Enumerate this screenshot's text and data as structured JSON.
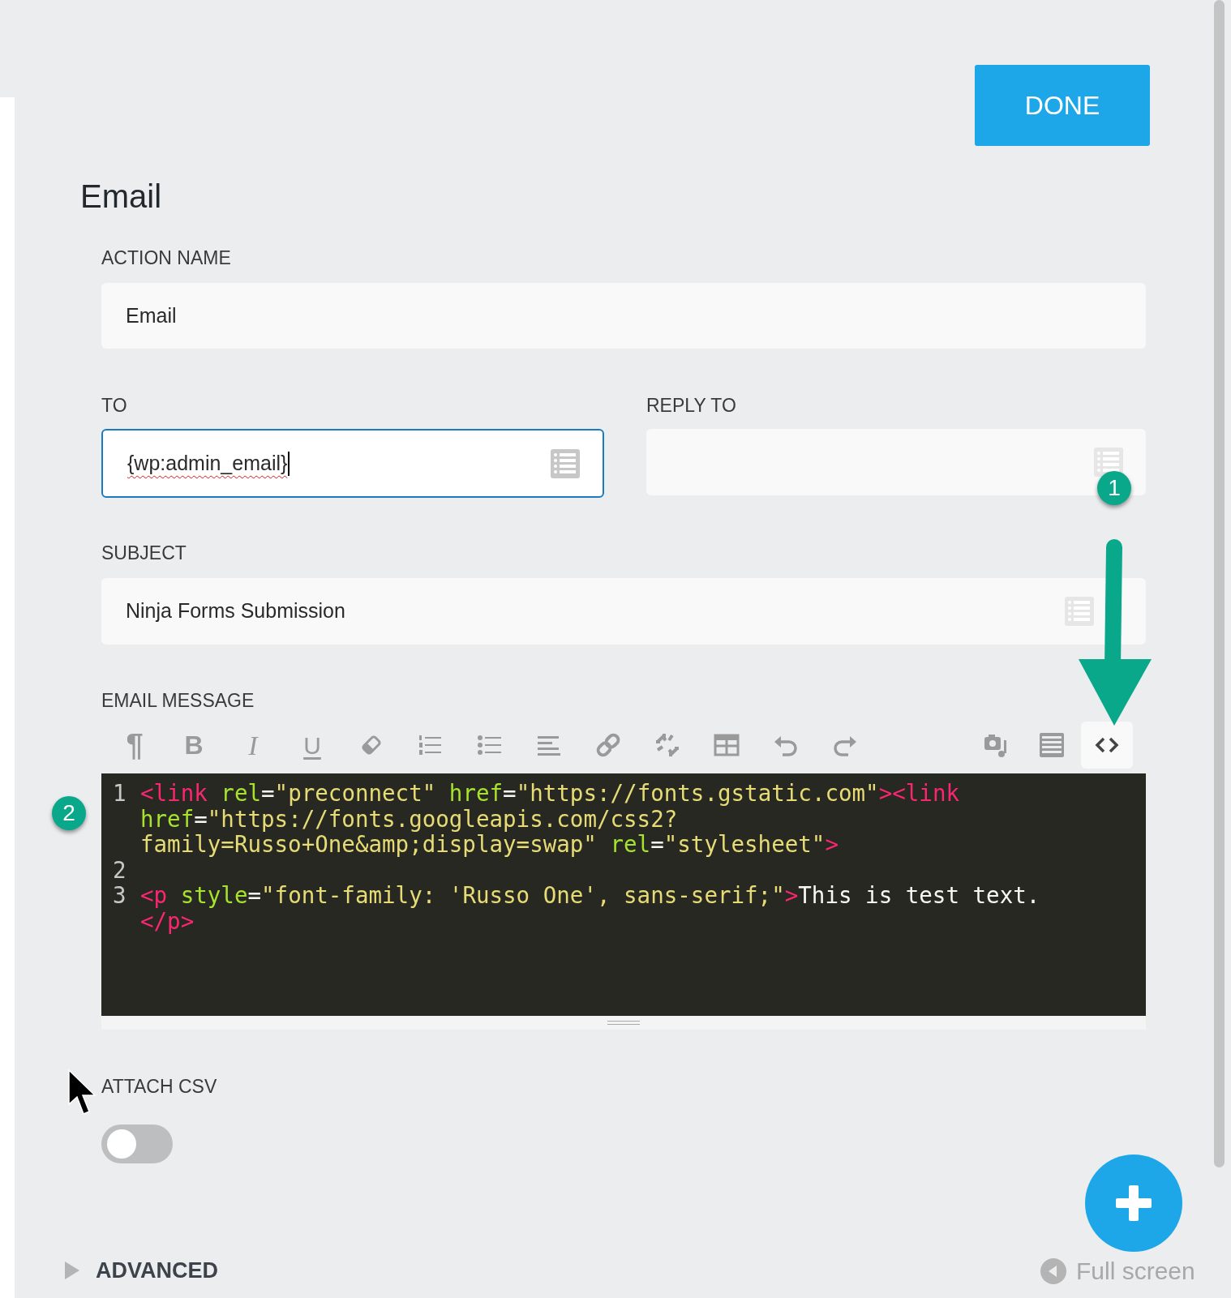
{
  "done_button": "DONE",
  "heading": "Email",
  "action_name": {
    "label": "ACTION NAME",
    "value": "Email"
  },
  "to": {
    "label": "TO",
    "value": "{wp:admin_email}",
    "focused": true
  },
  "reply_to": {
    "label": "REPLY TO",
    "focused": false
  },
  "subject": {
    "label": "SUBJECT",
    "value": "Ninja Forms Submission",
    "focused": false
  },
  "email_message": {
    "label": "EMAIL MESSAGE",
    "toolbar": [
      {
        "kind": "glyph",
        "label": "¶",
        "selected": false
      },
      {
        "kind": "bold",
        "label": "B",
        "selected": false
      },
      {
        "kind": "italic",
        "label": "I",
        "selected": false
      },
      {
        "kind": "underline",
        "label": "U",
        "selected": false
      },
      {
        "kind": "eraser",
        "selected": false
      },
      {
        "kind": "ordered",
        "selected": false
      },
      {
        "kind": "bulleted",
        "selected": false
      },
      {
        "kind": "align",
        "selected": false
      },
      {
        "kind": "link",
        "selected": false
      },
      {
        "kind": "unlink",
        "selected": false
      },
      {
        "kind": "table",
        "selected": false
      },
      {
        "kind": "undo",
        "selected": false
      },
      {
        "kind": "redo",
        "selected": false
      },
      {
        "kind": "media",
        "selected": false
      },
      {
        "kind": "list",
        "selected": false
      },
      {
        "kind": "code",
        "selected": true
      }
    ],
    "code_lines": [
      {
        "number": "1",
        "rows": [
          {
            "tokens": [
              {
                "kind": "tag",
                "text": "<link"
              },
              {
                "kind": "attr",
                "text": " rel"
              },
              {
                "kind": "plain",
                "text": "="
              },
              {
                "kind": "string",
                "text": "\"preconnect\""
              },
              {
                "kind": "attr",
                "text": " href"
              },
              {
                "kind": "plain",
                "text": "="
              },
              {
                "kind": "string",
                "text": "\"https://fonts.gstatic.com\""
              },
              {
                "kind": "tag",
                "text": "><link"
              }
            ]
          },
          {
            "tokens": [
              {
                "kind": "attr",
                "text": "href"
              },
              {
                "kind": "plain",
                "text": "="
              },
              {
                "kind": "string",
                "text": "\"https://fonts.googleapis.com/css2?"
              }
            ]
          },
          {
            "tokens": [
              {
                "kind": "string",
                "text": "family=Russo+One&amp;display=swap\""
              },
              {
                "kind": "attr",
                "text": " rel"
              },
              {
                "kind": "plain",
                "text": "="
              },
              {
                "kind": "string",
                "text": "\"stylesheet\""
              },
              {
                "kind": "tag",
                "text": ">"
              }
            ]
          }
        ]
      },
      {
        "number": "2",
        "rows": [
          {}
        ]
      },
      {
        "number": "3",
        "rows": [
          {
            "tokens": [
              {
                "kind": "tag",
                "text": "<p"
              },
              {
                "kind": "attr",
                "text": " style"
              },
              {
                "kind": "plain",
                "text": "="
              },
              {
                "kind": "string",
                "text": "\"font-family: 'Russo One', sans-serif;\""
              },
              {
                "kind": "tag",
                "text": ">"
              },
              {
                "kind": "plain",
                "text": "This is test text."
              }
            ]
          },
          {
            "tokens": [
              {
                "kind": "tag",
                "text": "</p>"
              }
            ]
          }
        ]
      }
    ]
  },
  "attach_csv": {
    "label": "ATTACH CSV",
    "on": false
  },
  "advanced": {
    "label": "ADVANCED",
    "expanded": false
  },
  "full_screen": "Full screen",
  "annotations": [
    "1",
    "2"
  ]
}
